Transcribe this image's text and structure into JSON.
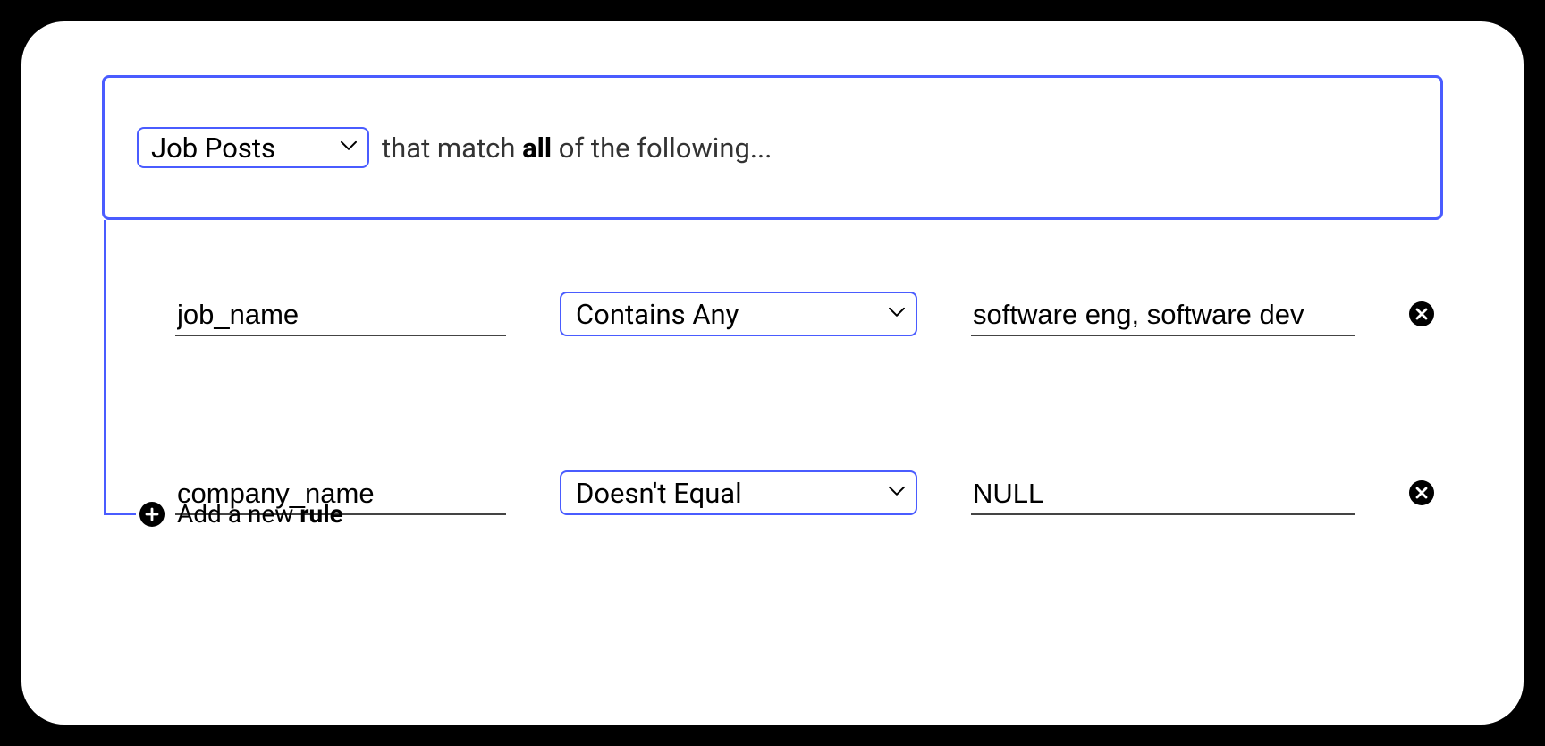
{
  "colors": {
    "accent": "#4a5cff",
    "text": "#000000",
    "bg": "#ffffff"
  },
  "header": {
    "thing_selected": "Job Posts",
    "desc_prefix": "that match ",
    "desc_bold": "all",
    "desc_suffix": " of the following..."
  },
  "rules": [
    {
      "field": "job_name",
      "operator": "Contains Any",
      "value": "software eng, software dev"
    },
    {
      "field": "company_name",
      "operator": "Doesn't Equal",
      "value": "NULL"
    }
  ],
  "add_rule": {
    "prefix": "Add a new ",
    "bold": "rule"
  }
}
